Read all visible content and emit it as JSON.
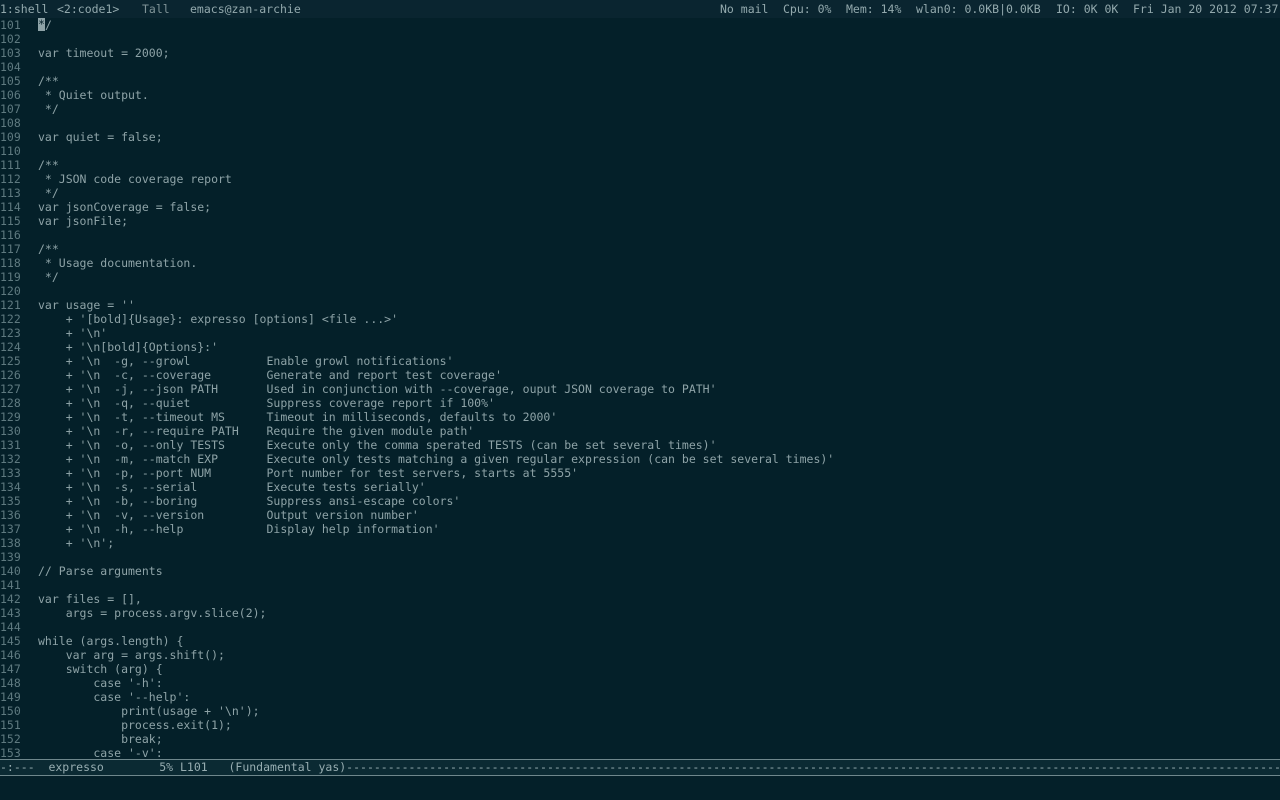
{
  "topbar": {
    "workspace_1": "1:shell",
    "workspace_2": "<2:code1>",
    "layout": "Tall",
    "window_title": "emacs@zan-archie",
    "mail": "No mail",
    "cpu": "Cpu: 0%",
    "mem": "Mem: 14%",
    "wlan": "wlan0: 0.0KB|0.0KB",
    "io": "IO: 0K 0K",
    "datetime": "Fri Jan 20 2012 07:37"
  },
  "editor": {
    "lines": [
      {
        "n": "101",
        "t": "*/",
        "cursor": true
      },
      {
        "n": "102",
        "t": ""
      },
      {
        "n": "103",
        "t": "var timeout = 2000;"
      },
      {
        "n": "104",
        "t": ""
      },
      {
        "n": "105",
        "t": "/**"
      },
      {
        "n": "106",
        "t": " * Quiet output."
      },
      {
        "n": "107",
        "t": " */"
      },
      {
        "n": "108",
        "t": ""
      },
      {
        "n": "109",
        "t": "var quiet = false;"
      },
      {
        "n": "110",
        "t": ""
      },
      {
        "n": "111",
        "t": "/**"
      },
      {
        "n": "112",
        "t": " * JSON code coverage report"
      },
      {
        "n": "113",
        "t": " */"
      },
      {
        "n": "114",
        "t": "var jsonCoverage = false;"
      },
      {
        "n": "115",
        "t": "var jsonFile;"
      },
      {
        "n": "116",
        "t": ""
      },
      {
        "n": "117",
        "t": "/**"
      },
      {
        "n": "118",
        "t": " * Usage documentation."
      },
      {
        "n": "119",
        "t": " */"
      },
      {
        "n": "120",
        "t": ""
      },
      {
        "n": "121",
        "t": "var usage = ''"
      },
      {
        "n": "122",
        "t": "    + '[bold]{Usage}: expresso [options] <file ...>'"
      },
      {
        "n": "123",
        "t": "    + '\\n'"
      },
      {
        "n": "124",
        "t": "    + '\\n[bold]{Options}:'"
      },
      {
        "n": "125",
        "t": "    + '\\n  -g, --growl           Enable growl notifications'"
      },
      {
        "n": "126",
        "t": "    + '\\n  -c, --coverage        Generate and report test coverage'"
      },
      {
        "n": "127",
        "t": "    + '\\n  -j, --json PATH       Used in conjunction with --coverage, ouput JSON coverage to PATH'"
      },
      {
        "n": "128",
        "t": "    + '\\n  -q, --quiet           Suppress coverage report if 100%'"
      },
      {
        "n": "129",
        "t": "    + '\\n  -t, --timeout MS      Timeout in milliseconds, defaults to 2000'"
      },
      {
        "n": "130",
        "t": "    + '\\n  -r, --require PATH    Require the given module path'"
      },
      {
        "n": "131",
        "t": "    + '\\n  -o, --only TESTS      Execute only the comma sperated TESTS (can be set several times)'"
      },
      {
        "n": "132",
        "t": "    + '\\n  -m, --match EXP       Execute only tests matching a given regular expression (can be set several times)'"
      },
      {
        "n": "133",
        "t": "    + '\\n  -p, --port NUM        Port number for test servers, starts at 5555'"
      },
      {
        "n": "134",
        "t": "    + '\\n  -s, --serial          Execute tests serially'"
      },
      {
        "n": "135",
        "t": "    + '\\n  -b, --boring          Suppress ansi-escape colors'"
      },
      {
        "n": "136",
        "t": "    + '\\n  -v, --version         Output version number'"
      },
      {
        "n": "137",
        "t": "    + '\\n  -h, --help            Display help information'"
      },
      {
        "n": "138",
        "t": "    + '\\n';"
      },
      {
        "n": "139",
        "t": ""
      },
      {
        "n": "140",
        "t": "// Parse arguments"
      },
      {
        "n": "141",
        "t": ""
      },
      {
        "n": "142",
        "t": "var files = [],"
      },
      {
        "n": "143",
        "t": "    args = process.argv.slice(2);"
      },
      {
        "n": "144",
        "t": ""
      },
      {
        "n": "145",
        "t": "while (args.length) {"
      },
      {
        "n": "146",
        "t": "    var arg = args.shift();"
      },
      {
        "n": "147",
        "t": "    switch (arg) {"
      },
      {
        "n": "148",
        "t": "        case '-h':"
      },
      {
        "n": "149",
        "t": "        case '--help':"
      },
      {
        "n": "150",
        "t": "            print(usage + '\\n');"
      },
      {
        "n": "151",
        "t": "            process.exit(1);"
      },
      {
        "n": "152",
        "t": "            break;"
      },
      {
        "n": "153",
        "t": "        case '-v':"
      }
    ]
  },
  "modeline": {
    "text": "-:---  expresso        5% L101   (Fundamental yas)--------------------------------------------------------------------------------------------------------------------------------------------------"
  }
}
